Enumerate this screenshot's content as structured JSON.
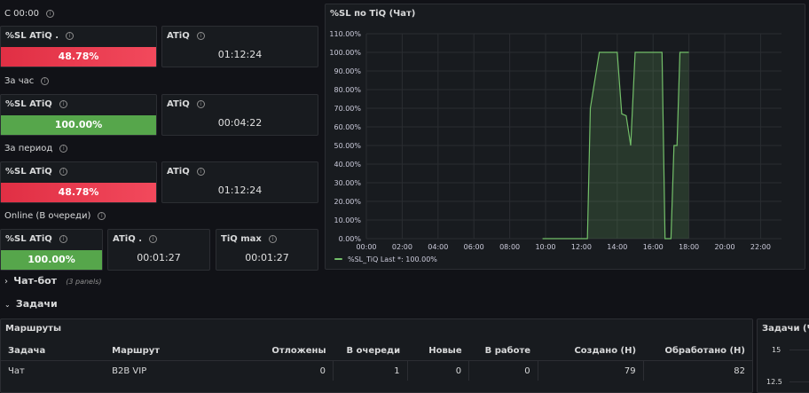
{
  "section1": {
    "label": "С 00:00",
    "sl_title": "%SL ATiQ .",
    "sl_value": "48.78%",
    "atiq_title": "ATiQ",
    "atiq_value": "01:12:24"
  },
  "section2": {
    "label": "За час",
    "sl_title": "%SL ATiQ",
    "sl_value": "100.00%",
    "atiq_title": "ATiQ",
    "atiq_value": "00:04:22"
  },
  "section3": {
    "label": "За период",
    "sl_title": "%SL ATiQ",
    "sl_value": "48.78%",
    "atiq_title": "ATiQ",
    "atiq_value": "01:12:24"
  },
  "section4": {
    "label": "Online (В очереди)",
    "sl_title": "%SL ATiQ",
    "sl_value": "100.00%",
    "atiq_title": "ATiQ .",
    "atiq_value": "00:01:27",
    "tiqmax_title": "TiQ max",
    "tiqmax_value": "00:01:27"
  },
  "chatbot_row": {
    "title": "Чат-бот",
    "count": "(3 panels)"
  },
  "tasks_row": {
    "title": "Задачи"
  },
  "routes_table": {
    "title": "Маршруты",
    "headers": [
      "Задача",
      "Маршрут",
      "Отложены",
      "В очереди",
      "Новые",
      "В работе",
      "Создано (Н)",
      "Обработано (Н)"
    ],
    "rows": [
      [
        "Чат",
        "B2B VIP",
        "0",
        "1",
        "0",
        "0",
        "79",
        "82"
      ]
    ]
  },
  "right_panel": {
    "title": "Задачи (Ча",
    "ticks": [
      "15",
      "12.5"
    ]
  },
  "chart_data": {
    "type": "area",
    "title": "%SL по TiQ (Чат)",
    "ylim": [
      0,
      110
    ],
    "y_ticks": [
      "0.00%",
      "10.00%",
      "20.00%",
      "30.00%",
      "40.00%",
      "50.00%",
      "60.00%",
      "70.00%",
      "80.00%",
      "90.00%",
      "100.00%",
      "110.00%"
    ],
    "x_ticks": [
      "00:00",
      "02:00",
      "04:00",
      "06:00",
      "08:00",
      "10:00",
      "12:00",
      "14:00",
      "16:00",
      "18:00",
      "20:00",
      "22:00"
    ],
    "series": [
      {
        "name": "%SL_TiQ",
        "color": "#73bf69",
        "x": [
          "09:50",
          "12:00",
          "12:20",
          "12:30",
          "13:00",
          "14:00",
          "14:15",
          "14:30",
          "14:45",
          "15:00",
          "15:20",
          "15:30",
          "16:00",
          "16:30",
          "16:40",
          "16:50",
          "17:00",
          "17:10",
          "17:20",
          "17:30",
          "17:45",
          "18:00"
        ],
        "values": [
          0,
          0,
          0,
          70,
          100,
          100,
          67,
          66,
          50,
          100,
          100,
          100,
          100,
          100,
          0,
          0,
          0,
          50,
          50,
          100,
          100,
          100
        ]
      }
    ],
    "legend": "%SL_TiQ  Last *: 100.00%",
    "legend_position": "bottom-left",
    "grid": true
  }
}
